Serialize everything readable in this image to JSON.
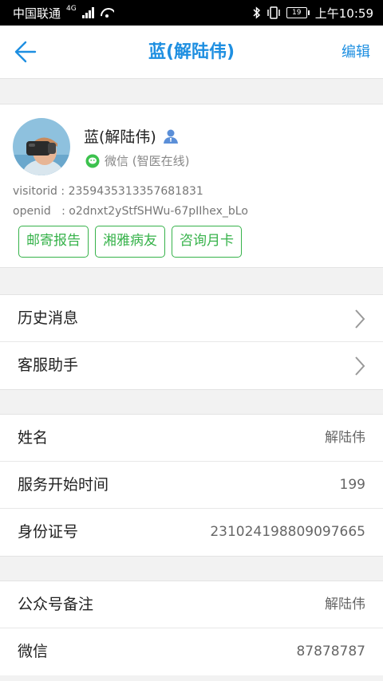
{
  "status_bar": {
    "carrier": "中国联通",
    "network": "4G",
    "battery": "19",
    "time": "上午10:59"
  },
  "nav": {
    "title": "蓝(解陆伟)",
    "edit_label": "编辑",
    "back_icon": "arrow-left-icon",
    "accent_color": "#1e8fe1"
  },
  "profile": {
    "name": "蓝(解陆伟)",
    "source": "微信 (智医在线)",
    "visitorid_label": "visitorid",
    "visitorid": "2359435313357681831",
    "openid_label": "openid",
    "openid": "o2dnxt2yStfSHWu-67pIIhex_bLo",
    "tags": [
      "邮寄报告",
      "湘雅病友",
      "咨询月卡"
    ],
    "tag_color": "#36b24a"
  },
  "menu": {
    "items": [
      {
        "label": "历史消息"
      },
      {
        "label": "客服助手"
      }
    ]
  },
  "info": {
    "rows": [
      {
        "label": "姓名",
        "value": "解陆伟"
      },
      {
        "label": "服务开始时间",
        "value": "199"
      },
      {
        "label": "身份证号",
        "value": "231024198809097665"
      }
    ]
  },
  "extra": {
    "rows": [
      {
        "label": "公众号备注",
        "value": "解陆伟"
      },
      {
        "label": "微信",
        "value": "87878787"
      }
    ]
  }
}
